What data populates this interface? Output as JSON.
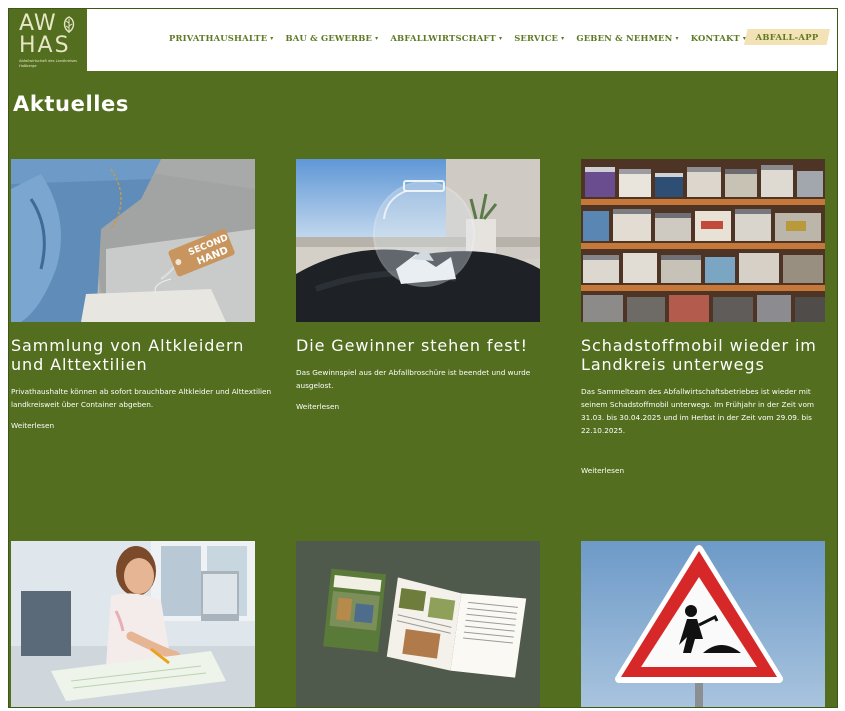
{
  "logo": {
    "line1": "AW",
    "line2": "HAS",
    "subtitle": "Abfallwirtschaft des Landkreises Haßberge"
  },
  "nav": {
    "items": [
      {
        "label": "PRIVATHAUSHALTE",
        "chevron": "▾"
      },
      {
        "label": "BAU & GEWERBE",
        "chevron": "▾"
      },
      {
        "label": "ABFALLWIRTSCHAFT",
        "chevron": "▾"
      },
      {
        "label": "SERVICE",
        "chevron": "▾"
      },
      {
        "label": "GEBEN & NEHMEN",
        "chevron": "▾"
      },
      {
        "label": "KONTAKT",
        "chevron": "▾"
      }
    ],
    "app_label": "ABFALL-APP"
  },
  "page": {
    "title": "Aktuelles"
  },
  "articles": [
    {
      "title": "Sammlung von Altkleidern und Alttextilien",
      "text": "Privathaushalte können ab sofort brauchbare Altkleider und Alttextilien landkreisweit über Container abgeben.",
      "more": "Weiterlesen",
      "tag_text": "SECOND HAND"
    },
    {
      "title": "Die Gewinner stehen fest!",
      "text": "Das Gewinnspiel aus der Abfallbroschüre ist beendet und wurde ausgelost.",
      "more": "Weiterlesen"
    },
    {
      "title": "Schadstoffmobil wieder im Landkreis unterwegs",
      "text": "Das Sammelteam des Abfallwirtschaftsbetriebes ist wieder mit seinem Schadstoffmobil unterwegs. Im Frühjahr in der Zeit vom 31.03. bis 30.04.2025 und im Herbst in der Zeit vom 29.09. bis 22.10.2025.",
      "more": "Weiterlesen"
    }
  ],
  "colors": {
    "brand_green": "#526e1e",
    "nav_green": "#5f7a25",
    "app_button": "#f2e2b5"
  },
  "icons": {
    "logo": "leaf-icon",
    "nav_dropdown": "chevron-down-icon"
  }
}
